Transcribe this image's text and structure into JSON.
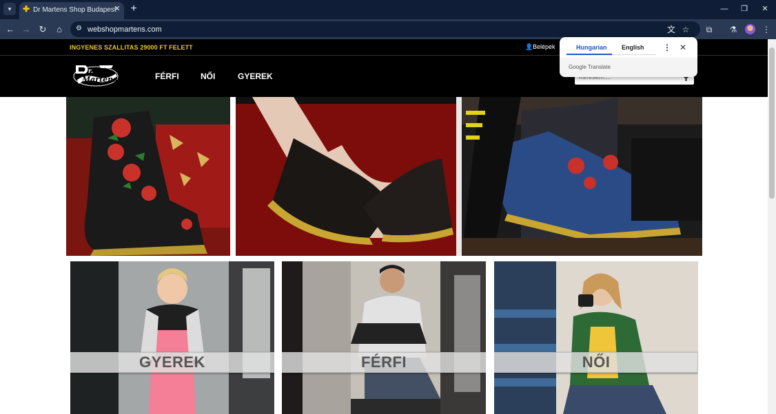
{
  "browser": {
    "tab_title": "Dr Martens Shop Budapest - Fé",
    "url": "webshopmartens.com",
    "icons": [
      "tab-list-icon",
      "favicon",
      "close-icon",
      "plus-icon",
      "minimize-icon",
      "restore-icon",
      "close-window-icon",
      "back-icon",
      "forward-icon",
      "reload-icon",
      "home-icon",
      "site-info-icon",
      "translate-icon",
      "star-icon",
      "extensions-icon",
      "labs-icon",
      "profile-avatar",
      "menu-icon"
    ]
  },
  "promo": {
    "text": "INGYENES SZALLITAS 29000 FT FELETT",
    "login_label": "Belépek",
    "color": "#e7c832"
  },
  "header": {
    "logo_text": "Dr. Martens",
    "nav": [
      "FÉRFI",
      "NŐI",
      "GYEREK"
    ],
    "search_placeholder": "Keresem...."
  },
  "categories": [
    {
      "label": "GYEREK"
    },
    {
      "label": "FÉRFI"
    },
    {
      "label": "NŐI"
    }
  ],
  "translate_popup": {
    "source_lang": "Hungarian",
    "target_lang": "English",
    "brand": "Google Translate",
    "accent": "#1a55c5"
  }
}
